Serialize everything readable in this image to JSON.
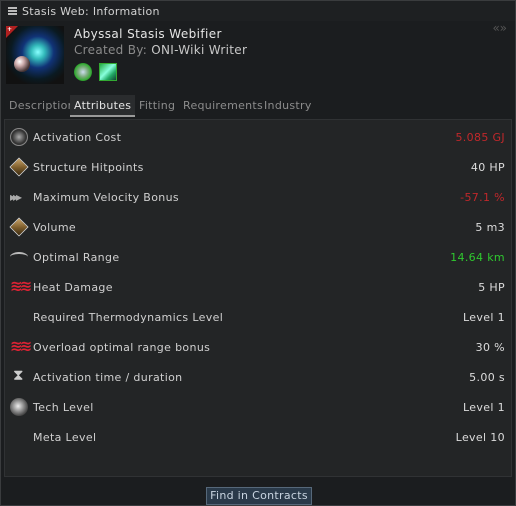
{
  "window": {
    "title": "Stasis Web: Information"
  },
  "item": {
    "name": "Abyssal Stasis Webifier",
    "created_by_label": "Created By:",
    "created_by_value": "ONI-Wiki Writer"
  },
  "tabs": [
    {
      "label": "Description",
      "active": false
    },
    {
      "label": "Attributes",
      "active": true
    },
    {
      "label": "Fitting",
      "active": false
    },
    {
      "label": "Requirements",
      "active": false
    },
    {
      "label": "Industry",
      "active": false
    }
  ],
  "attributes": [
    {
      "label": "Activation Cost",
      "value": "5.085 GJ",
      "color": "#c0282b",
      "icon": "capacitor-icon"
    },
    {
      "label": "Structure Hitpoints",
      "value": "40 HP",
      "color": "#dcdcdc",
      "icon": "structure-icon"
    },
    {
      "label": "Maximum Velocity Bonus",
      "value": "-57.1 %",
      "color": "#c0282b",
      "icon": "velocity-icon"
    },
    {
      "label": "Volume",
      "value": "5 m3",
      "color": "#dcdcdc",
      "icon": "volume-icon"
    },
    {
      "label": "Optimal Range",
      "value": "14.64 km",
      "color": "#2fc82f",
      "icon": "range-icon"
    },
    {
      "label": "Heat Damage",
      "value": "5 HP",
      "color": "#dcdcdc",
      "icon": "heat-icon"
    },
    {
      "label": "Required Thermodynamics Level",
      "value": "Level 1",
      "color": "#dcdcdc",
      "icon": ""
    },
    {
      "label": "Overload optimal range bonus",
      "value": "30 %",
      "color": "#dcdcdc",
      "icon": "heat-icon"
    },
    {
      "label": "Activation time / duration",
      "value": "5.00 s",
      "color": "#dcdcdc",
      "icon": "hourglass-icon"
    },
    {
      "label": "Tech Level",
      "value": "Level 1",
      "color": "#dcdcdc",
      "icon": "tech-icon"
    },
    {
      "label": "Meta Level",
      "value": "Level 10",
      "color": "#dcdcdc",
      "icon": ""
    }
  ],
  "footer": {
    "button_label": "Find in Contracts"
  }
}
